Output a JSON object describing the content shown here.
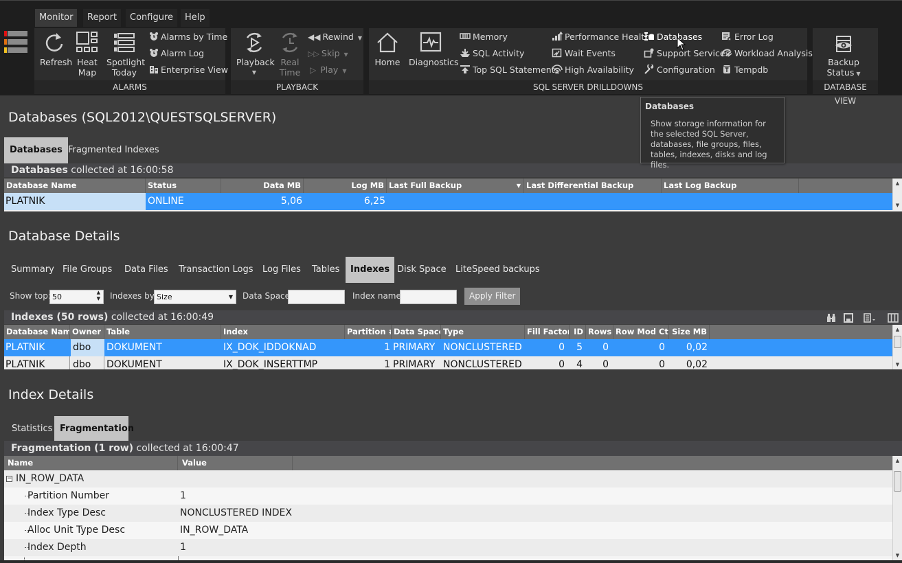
{
  "menu": {
    "tabs": [
      "Monitor",
      "Report",
      "Configure",
      "Help"
    ],
    "active_tab": "Monitor"
  },
  "ribbon": {
    "alarms": {
      "label": "ALARMS",
      "refresh": "Refresh",
      "heat_map": [
        "Heat",
        "Map"
      ],
      "spotlight_today": [
        "Spotlight",
        "Today"
      ],
      "alarms_by_time": "Alarms by Time",
      "alarm_log": "Alarm Log",
      "enterprise_view": "Enterprise View"
    },
    "playback": {
      "label": "PLAYBACK",
      "playback": "Playback",
      "real_time": [
        "Real",
        "Time"
      ],
      "rewind": "Rewind",
      "skip": "Skip",
      "play": "Play"
    },
    "drilldowns": {
      "label": "SQL SERVER DRILLDOWNS",
      "home": "Home",
      "diagnostics": "Diagnostics",
      "memory": "Memory",
      "sql_activity": "SQL Activity",
      "top_sql_statements": "Top SQL Statements",
      "performance_health": "Performance Health",
      "wait_events": "Wait Events",
      "high_availability": "High Availability",
      "databases": "Databases",
      "support_services": "Support Services",
      "configuration": "Configuration",
      "error_log": "Error Log",
      "workload_analysis": "Workload Analysis",
      "tempdb": "Tempdb"
    },
    "database_view": {
      "label": "DATABASE VIEW",
      "backup_status": [
        "Backup",
        "Status"
      ]
    }
  },
  "tooltip": {
    "title": "Databases",
    "body": "Show storage information for the selected SQL Server, databases, file groups, files, tables, indexes, disks and log files."
  },
  "databases_section": {
    "title": "Databases (SQL2012\\QUESTSQLSERVER)",
    "tabs": [
      "Databases",
      "Fragmented Indexes"
    ],
    "active_tab": "Databases",
    "collected_bold": "Databases",
    "collected_text": " collected at 16:00:58",
    "columns": [
      "Database Name",
      "Status",
      "Data MB",
      "Log MB",
      "Last Full Backup",
      "Last Differential Backup",
      "Last Log Backup"
    ],
    "rows": [
      {
        "database_name": "PLATNIK",
        "status": "ONLINE",
        "data_mb": "5,06",
        "log_mb": "6,25",
        "last_full_backup": "",
        "last_differential_backup": "",
        "last_log_backup": ""
      }
    ]
  },
  "database_details": {
    "title": "Database Details",
    "tabs": [
      "Summary",
      "File Groups",
      "Data Files",
      "Transaction Logs",
      "Log Files",
      "Tables",
      "Indexes",
      "Disk Space",
      "LiteSpeed backups"
    ],
    "active_tab": "Indexes",
    "filter": {
      "show_top_label": "Show top:",
      "show_top_value": "50",
      "indexes_by_label": "Indexes by:",
      "indexes_by_value": "Size",
      "data_space_label": "Data Space:",
      "data_space_value": "",
      "index_name_label": "Index name:",
      "index_name_value": "",
      "apply_label": "Apply Filter"
    },
    "collected_bold": "Indexes (50 rows)",
    "collected_text": " collected at 16:00:49",
    "columns": [
      "Database Name",
      "Owner",
      "Table",
      "Index",
      "Partition #",
      "Data Space",
      "Type",
      "Fill Factor",
      "ID",
      "Rows",
      "Row Mod Ctr",
      "Size MB"
    ],
    "rows": [
      {
        "database_name": "PLATNIK",
        "owner": "dbo",
        "table": "DOKUMENT",
        "index": "IX_DOK_IDDOKNAD",
        "partition": "1",
        "data_space": "PRIMARY",
        "type": "NONCLUSTERED",
        "fill_factor": "0",
        "id": "5",
        "rows": "0",
        "row_mod_ctr": "0",
        "size_mb": "0,02"
      },
      {
        "database_name": "PLATNIK",
        "owner": "dbo",
        "table": "DOKUMENT",
        "index": "IX_DOK_INSERTTMP",
        "partition": "1",
        "data_space": "PRIMARY",
        "type": "NONCLUSTERED",
        "fill_factor": "0",
        "id": "4",
        "rows": "0",
        "row_mod_ctr": "0",
        "size_mb": "0,02"
      }
    ]
  },
  "index_details": {
    "title": "Index Details",
    "tabs": [
      "Statistics",
      "Fragmentation"
    ],
    "active_tab": "Fragmentation",
    "collected_bold": "Fragmentation (1 row)",
    "collected_text": " collected at 16:00:47",
    "columns": [
      "Name",
      "Value"
    ],
    "group": "IN_ROW_DATA",
    "rows": [
      {
        "name": "Partition Number",
        "value": "1"
      },
      {
        "name": "Index Type Desc",
        "value": "NONCLUSTERED INDEX"
      },
      {
        "name": "Alloc Unit Type Desc",
        "value": "IN_ROW_DATA"
      },
      {
        "name": "Index Depth",
        "value": "1"
      }
    ]
  },
  "colors": {
    "selection": "#3496fb",
    "focus_cell": "#c7e0f7",
    "header": "#717171",
    "ribbon_bg": "#2d2d2d",
    "page_bg": "#3c3c3c",
    "logo_red": "#e01010",
    "logo_orange": "#e07010",
    "logo_yellow": "#f0c020"
  }
}
